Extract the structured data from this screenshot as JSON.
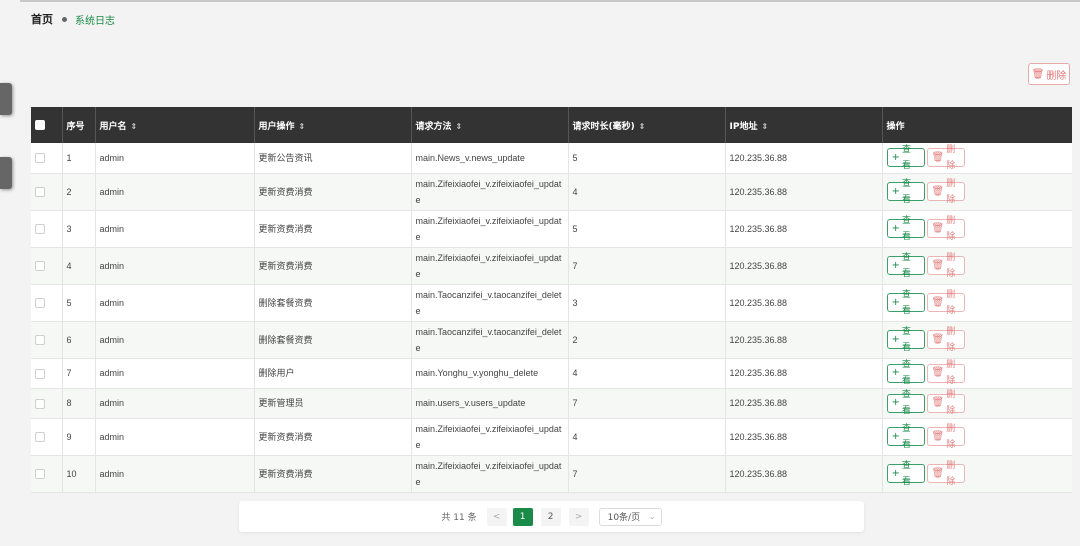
{
  "breadcrumb": {
    "home": "首页",
    "current": "系统日志"
  },
  "toolbar": {
    "delete_label": "删除",
    "delete_icon": "trash-icon"
  },
  "table": {
    "columns": [
      "序号",
      "用户名",
      "用户操作",
      "请求方法",
      "请求时长(毫秒)",
      "IP地址",
      "操作"
    ],
    "sortable": [
      false,
      true,
      true,
      true,
      true,
      true,
      false
    ],
    "rows": [
      {
        "no": "1",
        "user": "admin",
        "op": "更新公告资讯",
        "method": "main.News_v.news_update",
        "duration": "5",
        "ip": "120.235.36.88"
      },
      {
        "no": "2",
        "user": "admin",
        "op": "更新资费消费",
        "method": "main.Zifeixiaofei_v.zifeixiaofei_update",
        "duration": "4",
        "ip": "120.235.36.88"
      },
      {
        "no": "3",
        "user": "admin",
        "op": "更新资费消费",
        "method": "main.Zifeixiaofei_v.zifeixiaofei_update",
        "duration": "5",
        "ip": "120.235.36.88"
      },
      {
        "no": "4",
        "user": "admin",
        "op": "更新资费消费",
        "method": "main.Zifeixiaofei_v.zifeixiaofei_update",
        "duration": "7",
        "ip": "120.235.36.88"
      },
      {
        "no": "5",
        "user": "admin",
        "op": "删除套餐资费",
        "method": "main.Taocanzifei_v.taocanzifei_delete",
        "duration": "3",
        "ip": "120.235.36.88"
      },
      {
        "no": "6",
        "user": "admin",
        "op": "删除套餐资费",
        "method": "main.Taocanzifei_v.taocanzifei_delete",
        "duration": "2",
        "ip": "120.235.36.88"
      },
      {
        "no": "7",
        "user": "admin",
        "op": "删除用户",
        "method": "main.Yonghu_v.yonghu_delete",
        "duration": "4",
        "ip": "120.235.36.88"
      },
      {
        "no": "8",
        "user": "admin",
        "op": "更新管理员",
        "method": "main.users_v.users_update",
        "duration": "7",
        "ip": "120.235.36.88"
      },
      {
        "no": "9",
        "user": "admin",
        "op": "更新资费消费",
        "method": "main.Zifeixiaofei_v.zifeixiaofei_update",
        "duration": "4",
        "ip": "120.235.36.88"
      },
      {
        "no": "10",
        "user": "admin",
        "op": "更新资费消费",
        "method": "main.Zifeixiaofei_v.zifeixiaofei_update",
        "duration": "7",
        "ip": "120.235.36.88"
      }
    ],
    "view_label": "查看",
    "delete_label": "删除"
  },
  "pagination": {
    "total": "共 11 条",
    "prev": "<",
    "next": ">",
    "pages": [
      "1",
      "2"
    ],
    "current": "1",
    "page_size": "10条/页"
  },
  "colors": {
    "accent": "#1a8a48",
    "danger": "#e57373",
    "header_bg": "#333333"
  }
}
